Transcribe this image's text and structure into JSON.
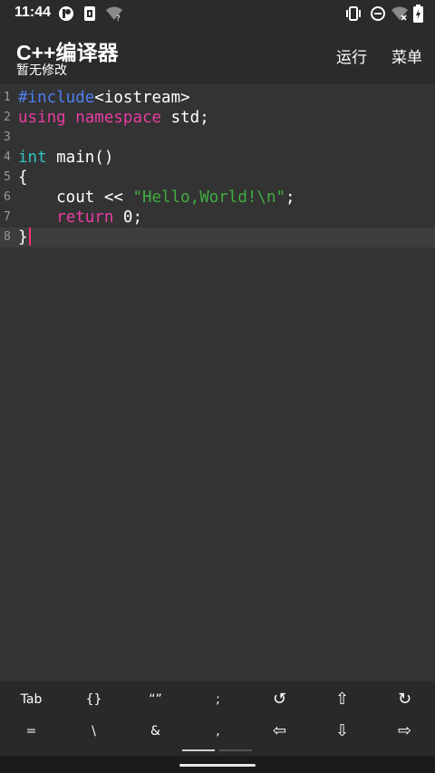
{
  "status_bar": {
    "time": "11:44",
    "icons": [
      "media-app-icon",
      "sim-card-icon",
      "wifi-unknown-icon",
      "vibrate-icon",
      "do-not-disturb-icon",
      "wifi-off-icon",
      "battery-charging-icon"
    ]
  },
  "app_bar": {
    "title": "C++编译器",
    "subtitle": "暂无修改",
    "run_label": "运行",
    "menu_label": "菜单"
  },
  "editor": {
    "lines": [
      {
        "number": "1",
        "tokens": [
          {
            "text": "#include",
            "color": "#4e7ff0"
          },
          {
            "text": "<iostream>",
            "color": "#ffffff"
          }
        ]
      },
      {
        "number": "2",
        "tokens": [
          {
            "text": "using",
            "color": "#e83ca3"
          },
          {
            "text": " ",
            "color": "#ffffff"
          },
          {
            "text": "namespace",
            "color": "#e83ca3"
          },
          {
            "text": " std;",
            "color": "#ffffff"
          }
        ]
      },
      {
        "number": "3",
        "tokens": []
      },
      {
        "number": "4",
        "tokens": [
          {
            "text": "int",
            "color": "#33c4c4"
          },
          {
            "text": " main()",
            "color": "#ffffff"
          }
        ]
      },
      {
        "number": "5",
        "tokens": [
          {
            "text": "{",
            "color": "#ffffff"
          }
        ]
      },
      {
        "number": "6",
        "tokens": [
          {
            "text": "    cout << ",
            "color": "#ffffff"
          },
          {
            "text": "\"Hello,World!\\n\"",
            "color": "#3fae3f"
          },
          {
            "text": ";",
            "color": "#ffffff"
          }
        ]
      },
      {
        "number": "7",
        "tokens": [
          {
            "text": "    ",
            "color": "#ffffff"
          },
          {
            "text": "return",
            "color": "#e83ca3"
          },
          {
            "text": " 0;",
            "color": "#ffffff"
          }
        ]
      },
      {
        "number": "8",
        "tokens": [
          {
            "text": "}",
            "color": "#ffffff"
          }
        ],
        "current": true
      }
    ],
    "caret_color": "#ff2e7a"
  },
  "keyboard": {
    "row1": [
      "Tab",
      "{}",
      "“”",
      ";",
      "↺",
      "⇧",
      "↻"
    ],
    "row2": [
      "=",
      "\\",
      "&",
      ",",
      "⇦",
      "⇩",
      "⇨"
    ],
    "active_page": 0
  },
  "colors": {
    "background": "#333333",
    "app_bar": "#2b2b2b",
    "keyword_pink": "#e83ca3",
    "keyword_blue": "#4e7ff0",
    "type_cyan": "#33c4c4",
    "string_green": "#3fae3f"
  }
}
